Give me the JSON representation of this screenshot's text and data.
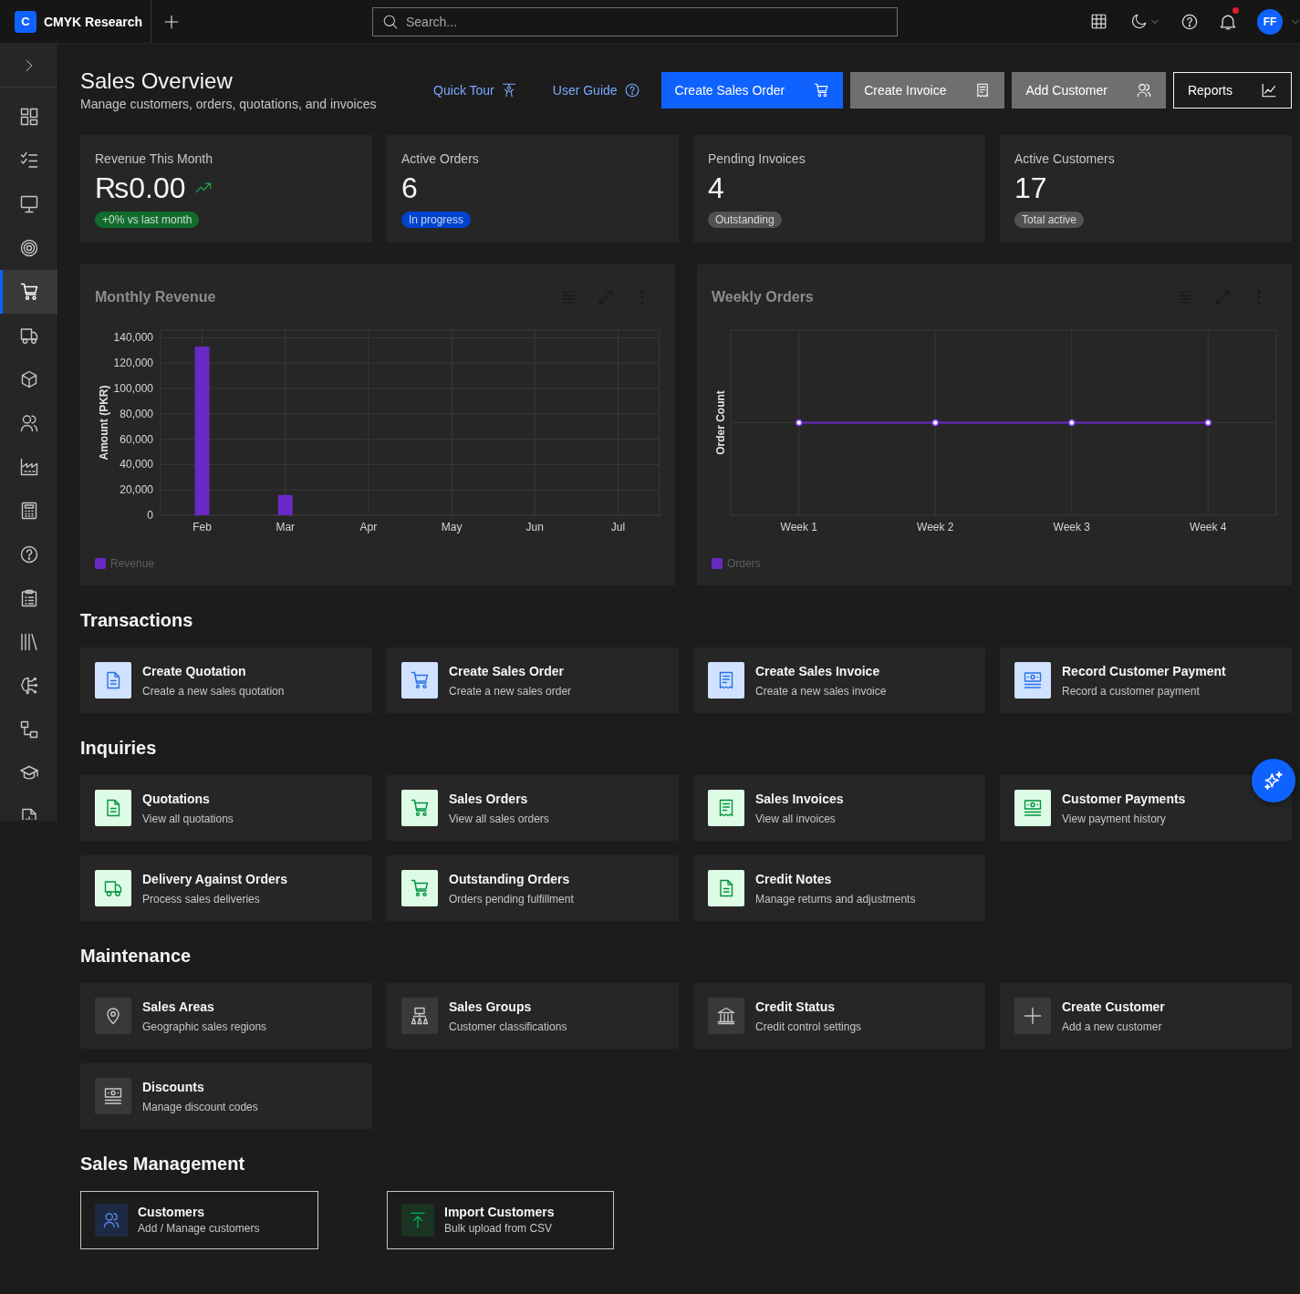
{
  "top_bar": {
    "logo_letter": "C",
    "app_name": "CMYK Research",
    "search": {
      "placeholder": "Search..."
    },
    "notifications": {
      "unread": true
    },
    "avatar": {
      "initials": "FF"
    }
  },
  "sidebar": {
    "items": [
      {
        "selected": false
      },
      {
        "selected": false
      },
      {
        "selected": false
      },
      {
        "selected": false
      },
      {
        "selected": true
      },
      {
        "selected": false
      },
      {
        "selected": false
      },
      {
        "selected": false
      },
      {
        "selected": false
      },
      {
        "selected": false
      },
      {
        "selected": false
      },
      {
        "selected": false
      },
      {
        "selected": false
      },
      {
        "selected": false
      },
      {
        "selected": false
      },
      {
        "selected": false
      },
      {
        "selected": false
      }
    ]
  },
  "header": {
    "title": "Sales Overview",
    "subtitle": "Manage customers, orders, quotations, and invoices",
    "links": [
      {
        "label": "Quick Tour"
      },
      {
        "label": "User Guide"
      }
    ],
    "buttons": [
      {
        "label": "Create Sales Order",
        "kind": "primary"
      },
      {
        "label": "Create Invoice",
        "kind": "secondary"
      },
      {
        "label": "Add Customer",
        "kind": "secondary"
      },
      {
        "label": "Reports",
        "kind": "tertiary"
      }
    ]
  },
  "stats": [
    {
      "label": "Revenue This Month",
      "value": "₨0.00",
      "trending_up": true,
      "badge": {
        "label": "+0% vs last month",
        "color": "#116b2c"
      }
    },
    {
      "label": "Active Orders",
      "value": "6",
      "trending_up": false,
      "badge": {
        "label": "In progress",
        "color": "#0043ce"
      }
    },
    {
      "label": "Pending Invoices",
      "value": "4",
      "trending_up": false,
      "badge": {
        "label": "Outstanding",
        "color": "#525252"
      }
    },
    {
      "label": "Active Customers",
      "value": "17",
      "trending_up": false,
      "badge": {
        "label": "Total active",
        "color": "#525252"
      }
    }
  ],
  "charts": {
    "monthly_revenue": {
      "chart_data": {
        "type": "bar",
        "title": "Monthly Revenue",
        "ylabel": "Amount (PKR)",
        "categories": [
          "Feb",
          "Mar",
          "Apr",
          "May",
          "Jun",
          "Jul"
        ],
        "series": [
          {
            "name": "Revenue",
            "color": "#6929c4",
            "values": [
              133000,
              16000,
              0,
              0,
              0,
              0
            ]
          }
        ],
        "ylim": [
          0,
          146000
        ],
        "yticks": [
          {
            "value": 0,
            "label": "0"
          },
          {
            "value": 20000,
            "label": "20,000"
          },
          {
            "value": 40000,
            "label": "40,000"
          },
          {
            "value": 60000,
            "label": "60,000"
          },
          {
            "value": 80000,
            "label": "80,000"
          },
          {
            "value": 100000,
            "label": "100,000"
          },
          {
            "value": 120000,
            "label": "120,000"
          },
          {
            "value": 140000,
            "label": "140,000"
          }
        ],
        "grid": true
      }
    },
    "weekly_orders": {
      "title": "Weekly Orders",
      "ylabel": "Order Count",
      "categories": [
        "Week 1",
        "Week 2",
        "Week 3",
        "Week 4"
      ],
      "legend": "Orders"
    }
  },
  "sections": [
    {
      "title": "Transactions",
      "color": "#d0e2ff",
      "tinted": true,
      "cards": [
        {
          "title": "Create Quotation",
          "description": "Create a new sales quotation",
          "kind": "quotation"
        },
        {
          "title": "Create Sales Order",
          "description": "Create a new sales order",
          "kind": "order"
        },
        {
          "title": "Create Sales Invoice",
          "description": "Create a new sales invoice",
          "kind": "invoice"
        },
        {
          "title": "Record Customer Payment",
          "description": "Record a customer payment",
          "kind": "payment"
        }
      ]
    },
    {
      "title": "Inquiries",
      "color": "#defbe6",
      "tinted": true,
      "cards": [
        {
          "title": "Quotations",
          "description": "View all quotations",
          "kind": "quotation"
        },
        {
          "title": "Sales Orders",
          "description": "View all sales orders",
          "kind": "order"
        },
        {
          "title": "Sales Invoices",
          "description": "View all invoices",
          "kind": "invoice"
        },
        {
          "title": "Customer Payments",
          "description": "View payment history",
          "kind": "payment"
        },
        {
          "title": "Delivery Against Orders",
          "description": "Process sales deliveries",
          "kind": "delivery"
        },
        {
          "title": "Outstanding Orders",
          "description": "Orders pending fulfillment",
          "kind": "order"
        },
        {
          "title": "Credit Notes",
          "description": "Manage returns and adjustments",
          "kind": "note"
        }
      ]
    },
    {
      "title": "Maintenance",
      "color": "#393939",
      "tinted": false,
      "cards": [
        {
          "title": "Sales Areas",
          "description": "Geographic sales regions",
          "kind": "area"
        },
        {
          "title": "Sales Groups",
          "description": "Customer classifications",
          "kind": "group"
        },
        {
          "title": "Credit Status",
          "description": "Credit control settings",
          "kind": "credit"
        },
        {
          "title": "Create Customer",
          "description": "Add a new customer",
          "kind": "new"
        },
        {
          "title": "Discounts",
          "description": "Manage discount codes",
          "kind": "discount"
        }
      ]
    }
  ],
  "sales_management": {
    "title": "Sales Management",
    "cards": [
      {
        "title": "Customers",
        "description": "Add / Manage customers",
        "kind": "customers",
        "color": "#1e2a44"
      },
      {
        "title": "Import Customers",
        "description": "Bulk upload from CSV",
        "kind": "import",
        "color": "#1a3322"
      }
    ]
  }
}
